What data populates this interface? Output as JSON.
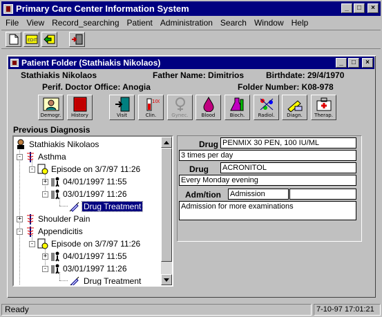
{
  "app": {
    "title": "Primary Care Center Information System"
  },
  "menu": [
    "File",
    "View",
    "Record_searching",
    "Patient",
    "Administration",
    "Search",
    "Window",
    "Help"
  ],
  "toolbar": {
    "buttons": [
      "new-doc-icon",
      "edit-icon",
      "back-icon",
      "exit-door-icon"
    ]
  },
  "folder": {
    "title": "Patient Folder (Stathiakis Nikolaos)",
    "patient_name": "Stathiakis Nikolaos",
    "father": "Father Name: Dimitrios",
    "birthdate": "Birthdate: 29/4/1970",
    "office": "Perif. Doctor Office: Anogia",
    "folder_number": "Folder Number:  K08-978",
    "buttons": [
      {
        "label": "Demogr.",
        "icon": "demographics-icon"
      },
      {
        "label": "History",
        "icon": "history-book-icon"
      },
      {
        "label": "Visit",
        "icon": "visit-door-icon"
      },
      {
        "label": "Clin.",
        "icon": "clinical-icon"
      },
      {
        "label": "Gynec.",
        "icon": "gynecology-icon",
        "disabled": true
      },
      {
        "label": "Blood",
        "icon": "blood-drop-icon"
      },
      {
        "label": "Bioch.",
        "icon": "biochemistry-flask-icon"
      },
      {
        "label": "Radiol.",
        "icon": "radiology-icon"
      },
      {
        "label": "Diagn.",
        "icon": "diagnosis-icon"
      },
      {
        "label": "Therap.",
        "icon": "therapy-kit-icon"
      }
    ]
  },
  "diagnosis": {
    "label": "Previous Diagnosis",
    "tree": {
      "root": "Stathiakis Nikolaos",
      "n1": "Asthma",
      "n2": "Episode on 3/7/97 11:26",
      "n3": "04/01/1997 11:55",
      "n4": "03/01/1997 11:26",
      "n5": "Drug Treatment",
      "n6": "Shoulder Pain",
      "n7": "Appendicitis",
      "n8": "Episode on 3/7/97 11:26",
      "n9": "04/01/1997 11:55",
      "n10": "03/01/1997 11:26",
      "n11": "Drug Treatment"
    }
  },
  "drug": {
    "drug_label": "Drug",
    "drug1": "PENMIX 30 PEN, 100 IU/ML",
    "dose1": "3 times per day",
    "drug2_label": "Drug",
    "drug2": "ACRONITOL",
    "dose2": "Every Monday evening",
    "adm_label": "Adm/tion",
    "adm_value": "Admission",
    "adm_extra": "",
    "notes": "Admission for more examinations"
  },
  "status": {
    "text": "Ready",
    "time": "7-10-97 17:01:21"
  }
}
